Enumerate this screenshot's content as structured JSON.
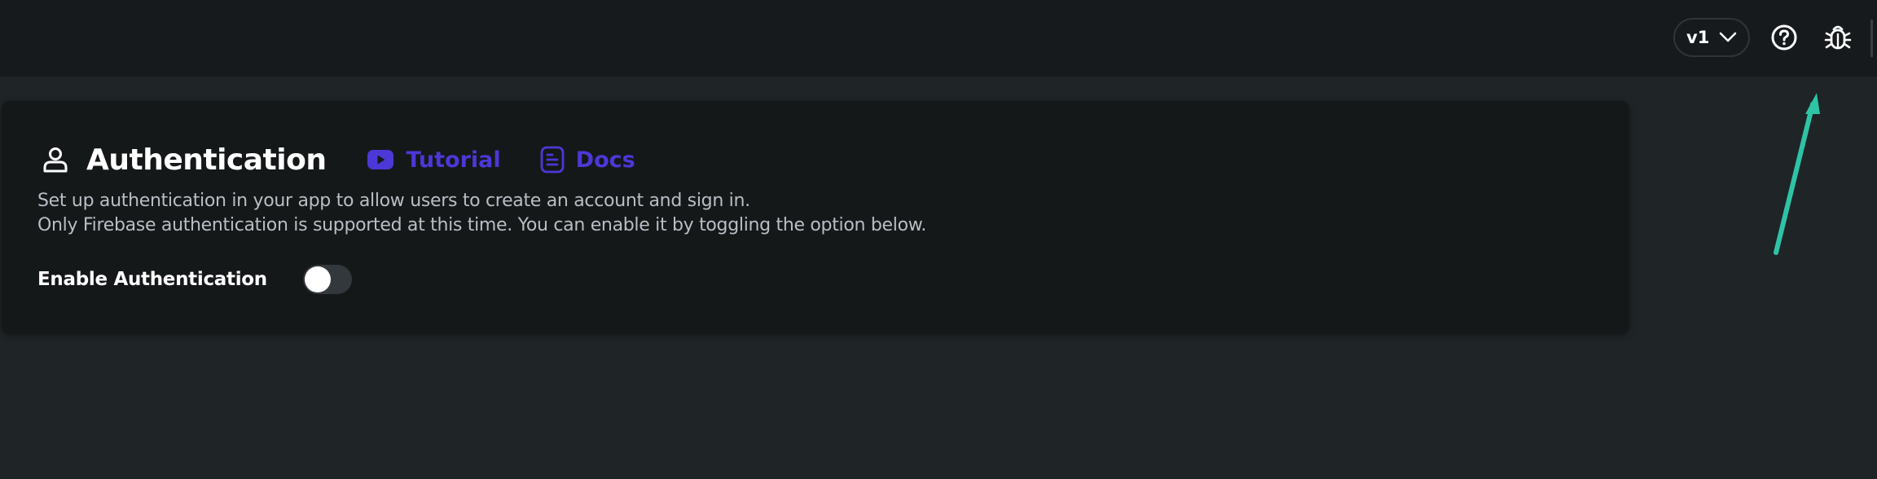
{
  "topbar": {
    "version": "v1"
  },
  "auth": {
    "title": "Authentication",
    "tutorial_label": "Tutorial",
    "docs_label": "Docs",
    "desc_line1": "Set up authentication in your app to allow users to create an account and sign in.",
    "desc_line2": "Only Firebase authentication is supported at this time. You can enable it by toggling the option below.",
    "enable_label": "Enable Authentication",
    "enabled": false
  },
  "colors": {
    "link": "#4c38d6",
    "annotation_arrow": "#2ec4a6"
  },
  "icons": [
    "chevron-down-icon",
    "help-icon",
    "bug-icon",
    "user-icon",
    "youtube-icon",
    "document-icon"
  ]
}
